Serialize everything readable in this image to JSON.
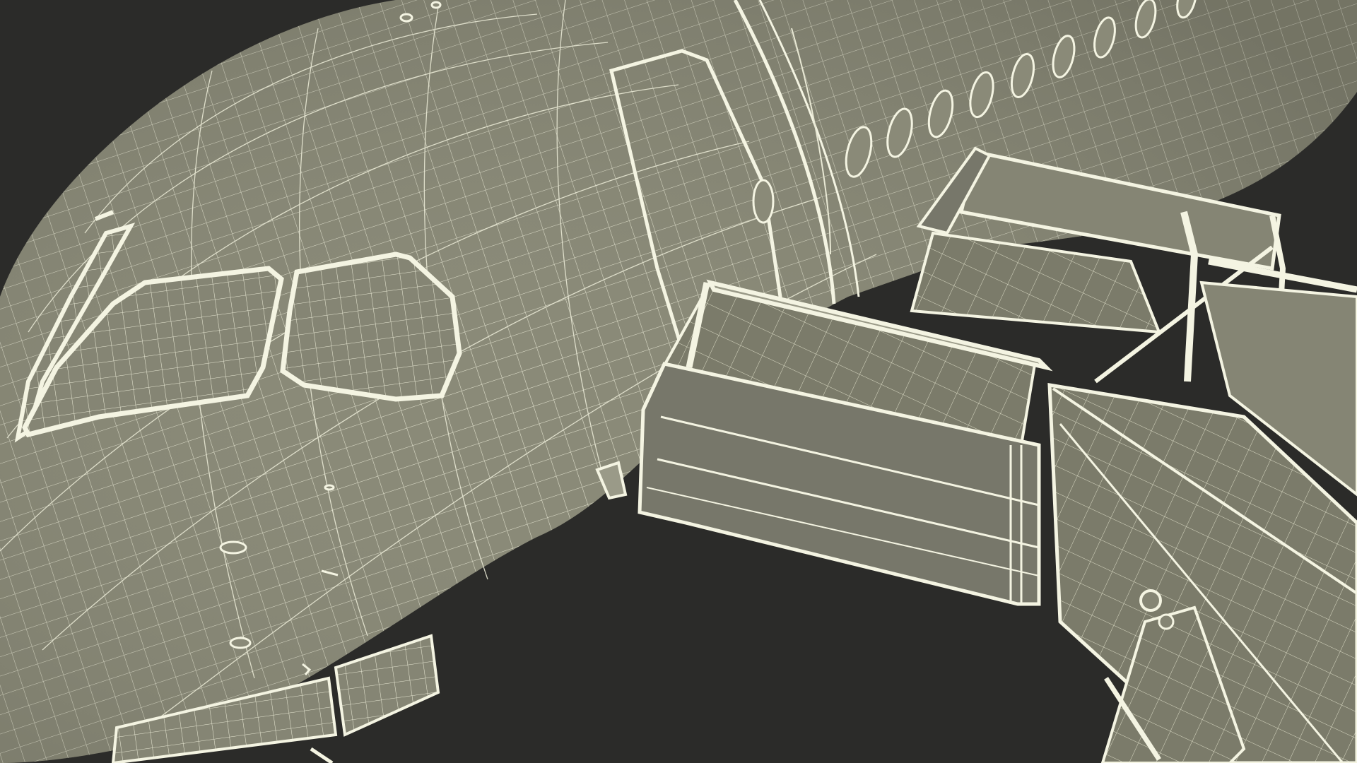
{
  "scene": {
    "subject": "wireframe-airplane-with-boarding-stairs",
    "colors": {
      "background": "#2b2b29",
      "surface": "#858574",
      "surface_dark": "#6f6f60",
      "surface_light": "#9a9a88",
      "wire": "#e8e8d4",
      "wire_bright": "#f4f4e2"
    },
    "counts": {
      "passenger_windows": 10
    }
  }
}
